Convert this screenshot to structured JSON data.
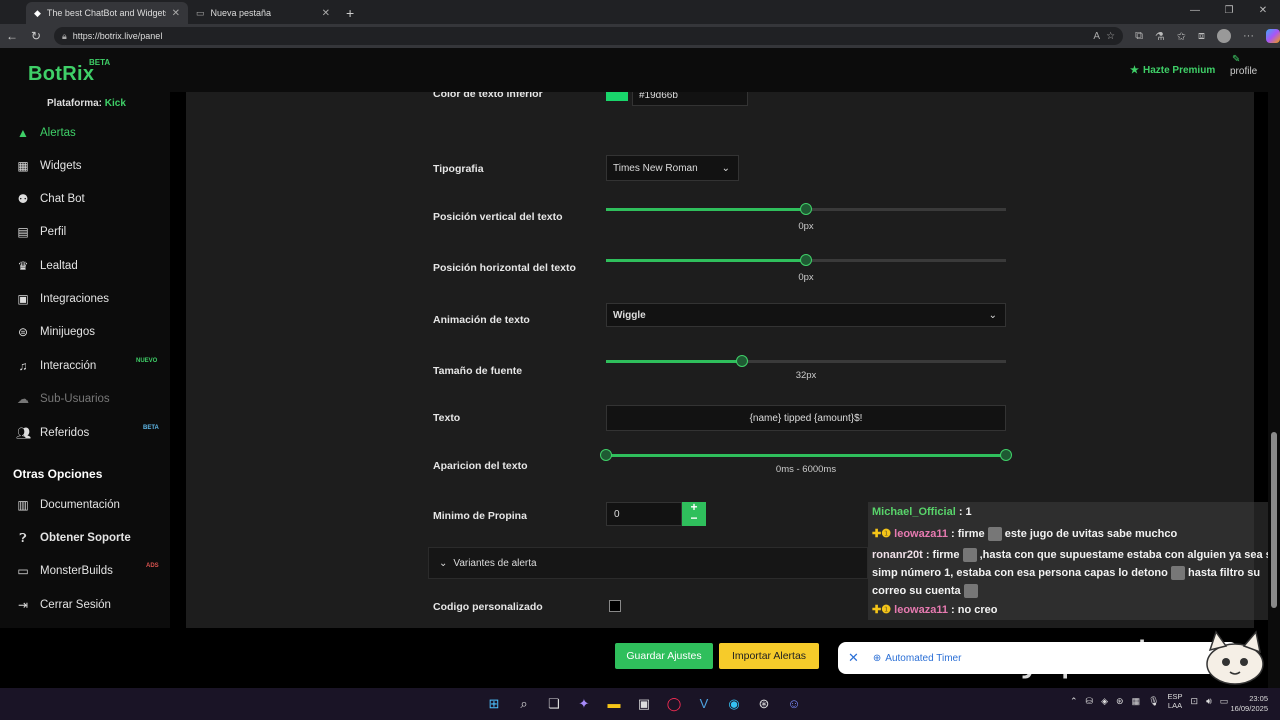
{
  "browser": {
    "tabs": [
      {
        "title": "The best ChatBot and Widgets fo",
        "active": true
      },
      {
        "title": "Nueva pestaña",
        "active": false
      }
    ],
    "new_tab": "+",
    "url": "https://botrix.live/panel"
  },
  "app": {
    "brand": "BotRix",
    "brand_badge": "BETA",
    "premium": "Hazte Premium",
    "profile": "profile",
    "accent": "#3fd068"
  },
  "sidebar": {
    "platform_label": "Plataforma:",
    "platform_value": "Kick",
    "items": [
      {
        "label": "Alertas",
        "icon": "warning-triangle-icon",
        "state": "active"
      },
      {
        "label": "Widgets",
        "icon": "grid-icon"
      },
      {
        "label": "Chat Bot",
        "icon": "robot-icon"
      },
      {
        "label": "Perfil",
        "icon": "id-card-icon"
      },
      {
        "label": "Lealtad",
        "icon": "trophy-icon"
      },
      {
        "label": "Integraciones",
        "icon": "integrations-icon"
      },
      {
        "label": "Minijuegos",
        "icon": "gamepad-icon"
      },
      {
        "label": "Interacción",
        "icon": "music-note-icon",
        "badge": "NUEVO"
      },
      {
        "label": "Sub-Usuarios",
        "icon": "users-icon",
        "state": "disabled"
      },
      {
        "label": "Referidos",
        "icon": "user-group-icon",
        "badge": "BETA"
      }
    ],
    "section_title": "Otras Opciones",
    "other_items": [
      {
        "label": "Documentación",
        "icon": "document-icon"
      },
      {
        "label": "Obtener Soporte",
        "icon": "question-icon"
      },
      {
        "label": "MonsterBuilds",
        "icon": "laptop-icon",
        "badge": "ADS"
      },
      {
        "label": "Cerrar Sesión",
        "icon": "logout-icon"
      }
    ]
  },
  "form": {
    "bottom_text_color_label": "Color de texto inferior",
    "bottom_text_color_value": "#19d66b",
    "typography_label": "Tipografia",
    "typography_value": "Times New Roman",
    "vertical_label": "Posición vertical del texto",
    "vertical_value": "0px",
    "vertical_fraction": 0.5,
    "horizontal_label": "Posición horizontal del texto",
    "horizontal_value": "0px",
    "horizontal_fraction": 0.5,
    "animation_label": "Animación de texto",
    "animation_value": "Wiggle",
    "font_size_label": "Tamaño de fuente",
    "font_size_value": "32px",
    "font_size_fraction": 0.34,
    "text_label": "Texto",
    "text_value": "{name} tipped {amount}$!",
    "appearance_label": "Aparicion del texto",
    "appearance_value": "0ms - 6000ms",
    "min_tip_label": "Minimo de Propina",
    "min_tip_value": "0",
    "variants_label": "Variantes de alerta",
    "custom_code_label": "Codigo personalizado"
  },
  "actions": {
    "save": "Guardar Ajustes",
    "import": "Importar Alertas"
  },
  "toast": {
    "label": "Automated Timer"
  },
  "overlay": {
    "caption": "soy pasivo"
  },
  "chat": {
    "messages": [
      {
        "user": "Michael_Official",
        "text": ": 1"
      },
      {
        "user": "leowaza11",
        "text1": ": firme",
        "text2": "este jugo de uvitas sabe muchco"
      },
      {
        "user": "ronanr20t",
        "text1": ": firme",
        "text2": ",hasta con que supuestame estaba con alguien ya sea s"
      },
      {
        "line2": "simp número 1, estaba con esa persona capas lo detono",
        "line2b": "hasta filtro su"
      },
      {
        "line3": "correo su cuenta"
      },
      {
        "user": "leowaza11",
        "text": ": no creo"
      }
    ]
  },
  "taskbar": {
    "lang_1": "ESP",
    "lang_2": "LAA",
    "time": "23:05",
    "date": "16/09/2025"
  }
}
